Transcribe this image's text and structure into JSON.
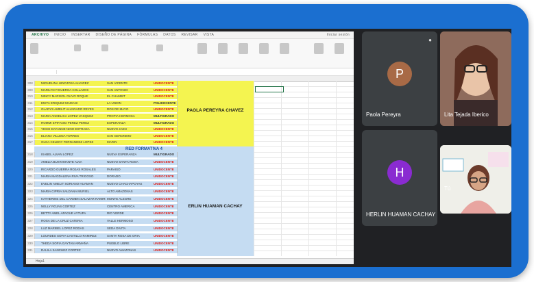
{
  "ribbon": {
    "tabs": [
      "ARCHIVO",
      "INICIO",
      "INSERTAR",
      "DISEÑO DE PÁGINA",
      "FÓRMULAS",
      "DATOS",
      "REVISAR",
      "VISTA"
    ],
    "share": "Iniciar sesión"
  },
  "sheet": {
    "yellow_rows": [
      {
        "n": "308",
        "name": "MIGUELINA HINOJOSA ALVAREZ",
        "school": "SAN VICENTE",
        "status": "UNIDOCENTE"
      },
      {
        "n": "309",
        "name": "MARILYN FIGUEROA COLLAZOS",
        "school": "SAN ANTONIO",
        "status": "UNIDOCENTE"
      },
      {
        "n": "310",
        "name": "MINCY MARISOL OLIVO ROQUE",
        "school": "EL CHAMBIT",
        "status": "UNIDOCENTE"
      },
      {
        "n": "311",
        "name": "ENITA ERIQUEZ MAMANI",
        "school": "LA UNION",
        "status": "POLIDOCENTE"
      },
      {
        "n": "312",
        "name": "GLADYS AMELIT ALVARADO REYES",
        "school": "DOS DE MAYO",
        "status": "UNIDOCENTE"
      },
      {
        "n": "313",
        "name": "MARIA ANGELICA LOPEZ VASQUEZ",
        "school": "PROPIA HERMOSA",
        "status": "MULTIGRADO"
      },
      {
        "n": "314",
        "name": "ROMMI EPIFANIO PEREZ PEREZ",
        "school": "ESPERANZA",
        "status": "MULTIGRADO"
      },
      {
        "n": "315",
        "name": "YESSI DAYANNE NINO ESTRADA",
        "school": "NUEVO JAEN",
        "status": "UNIDOCENTE"
      },
      {
        "n": "316",
        "name": "ELIANA VILLENA TORRES",
        "school": "SAN GERONIMO",
        "status": "UNIDOCENTE"
      },
      {
        "n": "317",
        "name": "OLGA CELENY FERNANDEZ LOPEZ",
        "school": "MARIN",
        "status": "UNIDOCENTE"
      }
    ],
    "section_header": "RED FORMATIVA 4",
    "blue_rows": [
      {
        "n": "318",
        "name": "ISABEL ALVAN LOPEZ",
        "school": "NUEVA ESPERANZA",
        "status": "MULTIGRADO"
      },
      {
        "n": "319",
        "name": "AMELIA BUSTAMANTE ALVA",
        "school": "NUEVO SANTA ROSA",
        "status": "UNIDOCENTE"
      },
      {
        "n": "320",
        "name": "RICARDO GUERRA ROJAS ROSALES",
        "school": "PARAISO",
        "status": "UNIDOCENTE"
      },
      {
        "n": "321",
        "name": "MARIA MAGDALENA RIVA TRIGOSO",
        "school": "DORADO",
        "status": "UNIDOCENTE"
      },
      {
        "n": "322",
        "name": "EVELIN AMELIT SORIANO HUAMAN",
        "school": "NUEVO CHACHAPOYAS",
        "status": "UNIDOCENTE"
      },
      {
        "n": "323",
        "name": "MARIA CIPRIA SALDANA MURIEL",
        "school": "ALTO AMAZONAS",
        "status": "UNIDOCENTE"
      },
      {
        "n": "324",
        "name": "KATHERINE DEL CARMEN SALAZAR RAMIREZ",
        "school": "MONTE ALEGRE",
        "status": "UNIDOCENTE"
      },
      {
        "n": "325",
        "name": "NELLY ROJAS CORTEZ",
        "school": "CENTRO AMERICA",
        "status": "UNIDOCENTE"
      },
      {
        "n": "326",
        "name": "BETTY AMEL APAGUE AYTUPA",
        "school": "RIO VERDE",
        "status": "UNIDOCENTE"
      },
      {
        "n": "327",
        "name": "ROSA DE LA CRUZ CATERIA",
        "school": "VALLE HERMOSO",
        "status": "UNIDOCENTE"
      },
      {
        "n": "328",
        "name": "LUZ MARIBEL LOPEZ RODAS",
        "school": "SEDA DIVITA",
        "status": "UNIDOCENTE"
      },
      {
        "n": "329",
        "name": "LOURDES SOFIA CASTILLO RAMIREZ",
        "school": "SANTA ROSA DE ORIA",
        "status": "UNIDOCENTE"
      },
      {
        "n": "330",
        "name": "THEDA SOFIA GAYTAN ARMAÑA",
        "school": "PUEBLO LIBRE",
        "status": "UNIDOCENTE"
      },
      {
        "n": "331",
        "name": "DALILA SANCHEZ CORTEZ",
        "school": "NUEVO AMAZONAS",
        "status": "UNIDOCENTE"
      }
    ],
    "tutor_yellow": "PAOLA PEREYRA CHAVEZ",
    "tutor_blue": "ERLIN HUAMAN CACHAY",
    "sheet_tab": "Hoja1"
  },
  "participants": {
    "paola": {
      "initial": "P",
      "name": "Paola Pereyra",
      "color": "#a86a46"
    },
    "lita": {
      "name": "Lita Tejada Iberico"
    },
    "herlin": {
      "initial": "H",
      "name": "HERLIN HUAMAN CACHAY",
      "color": "#8a2bd1"
    },
    "tu": {
      "name": "Tú"
    }
  }
}
